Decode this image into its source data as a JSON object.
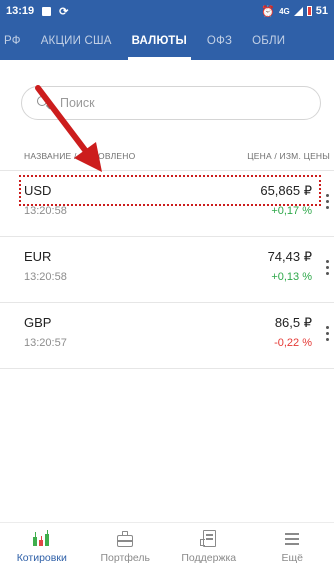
{
  "status_bar": {
    "time": "13:19",
    "network": "4G",
    "battery": "51"
  },
  "tabs": [
    {
      "label": "РФ",
      "active": false
    },
    {
      "label": "АКЦИИ США",
      "active": false
    },
    {
      "label": "ВАЛЮТЫ",
      "active": true
    },
    {
      "label": "ОФЗ",
      "active": false
    },
    {
      "label": "ОБЛИ",
      "active": false
    }
  ],
  "search": {
    "placeholder": "Поиск"
  },
  "columns": {
    "left": "НАЗВАНИЕ / ОБНОВЛЕНО",
    "right": "ЦЕНА / ИЗМ. ЦЕНЫ"
  },
  "rows": [
    {
      "ticker": "USD",
      "updated": "13:20:58",
      "price": "65,865 ₽",
      "change": "+0,17 %",
      "direction": "up"
    },
    {
      "ticker": "EUR",
      "updated": "13:20:58",
      "price": "74,43 ₽",
      "change": "+0,13 %",
      "direction": "up"
    },
    {
      "ticker": "GBP",
      "updated": "13:20:57",
      "price": "86,5 ₽",
      "change": "-0,22 %",
      "direction": "down"
    }
  ],
  "bottom_nav": [
    {
      "label": "Котировки",
      "icon": "candlestick-icon",
      "active": true
    },
    {
      "label": "Портфель",
      "icon": "briefcase-icon",
      "active": false
    },
    {
      "label": "Поддержка",
      "icon": "support-icon",
      "active": false
    },
    {
      "label": "Ещё",
      "icon": "menu-icon",
      "active": false
    }
  ],
  "colors": {
    "header_bg": "#2f60a8",
    "positive": "#2ea84a",
    "negative": "#e53935",
    "annotation": "#cc1d1d"
  }
}
